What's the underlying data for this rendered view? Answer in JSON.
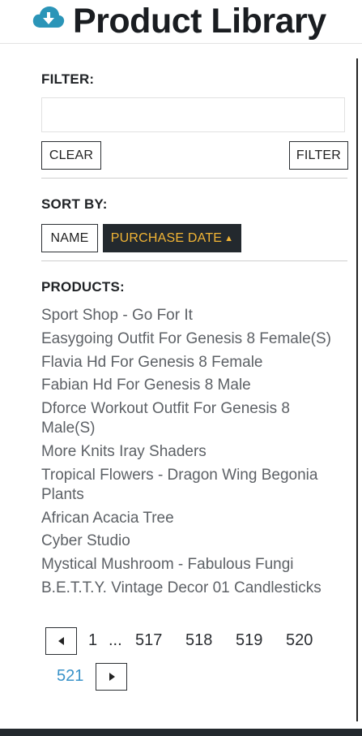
{
  "header": {
    "title": "Product Library",
    "logo_icon": "cloud-download-icon",
    "logo_color": "#2b95b8"
  },
  "filter": {
    "label": "FILTER:",
    "value": "",
    "placeholder": "",
    "clear_label": "CLEAR",
    "filter_label": "FILTER"
  },
  "sort": {
    "label": "SORT BY:",
    "options": [
      {
        "label": "NAME",
        "active": false
      },
      {
        "label": "PURCHASE DATE",
        "active": true,
        "direction_icon": "triangle-up-icon"
      }
    ],
    "active_color": "#f2b535"
  },
  "products": {
    "label": "PRODUCTS:",
    "items": [
      "Sport Shop - Go For It",
      "Easygoing Outfit For Genesis 8 Female(S)",
      "Flavia Hd For Genesis 8 Female",
      "Fabian Hd For Genesis 8 Male",
      "Dforce Workout Outfit For Genesis 8 Male(S)",
      "More Knits Iray Shaders",
      "Tropical Flowers - Dragon Wing Begonia Plants",
      "African Acacia Tree",
      "Cyber Studio",
      "Mystical Mushroom - Fabulous Fungi",
      "B.E.T.T.Y. Vintage Decor 01 Candlesticks"
    ]
  },
  "pagination": {
    "prev_icon": "triangle-left-icon",
    "next_icon": "triangle-right-icon",
    "pages": [
      "1",
      "...",
      "517",
      "518",
      "519",
      "520",
      "521"
    ],
    "current": "521",
    "current_color": "#3a93c9"
  }
}
